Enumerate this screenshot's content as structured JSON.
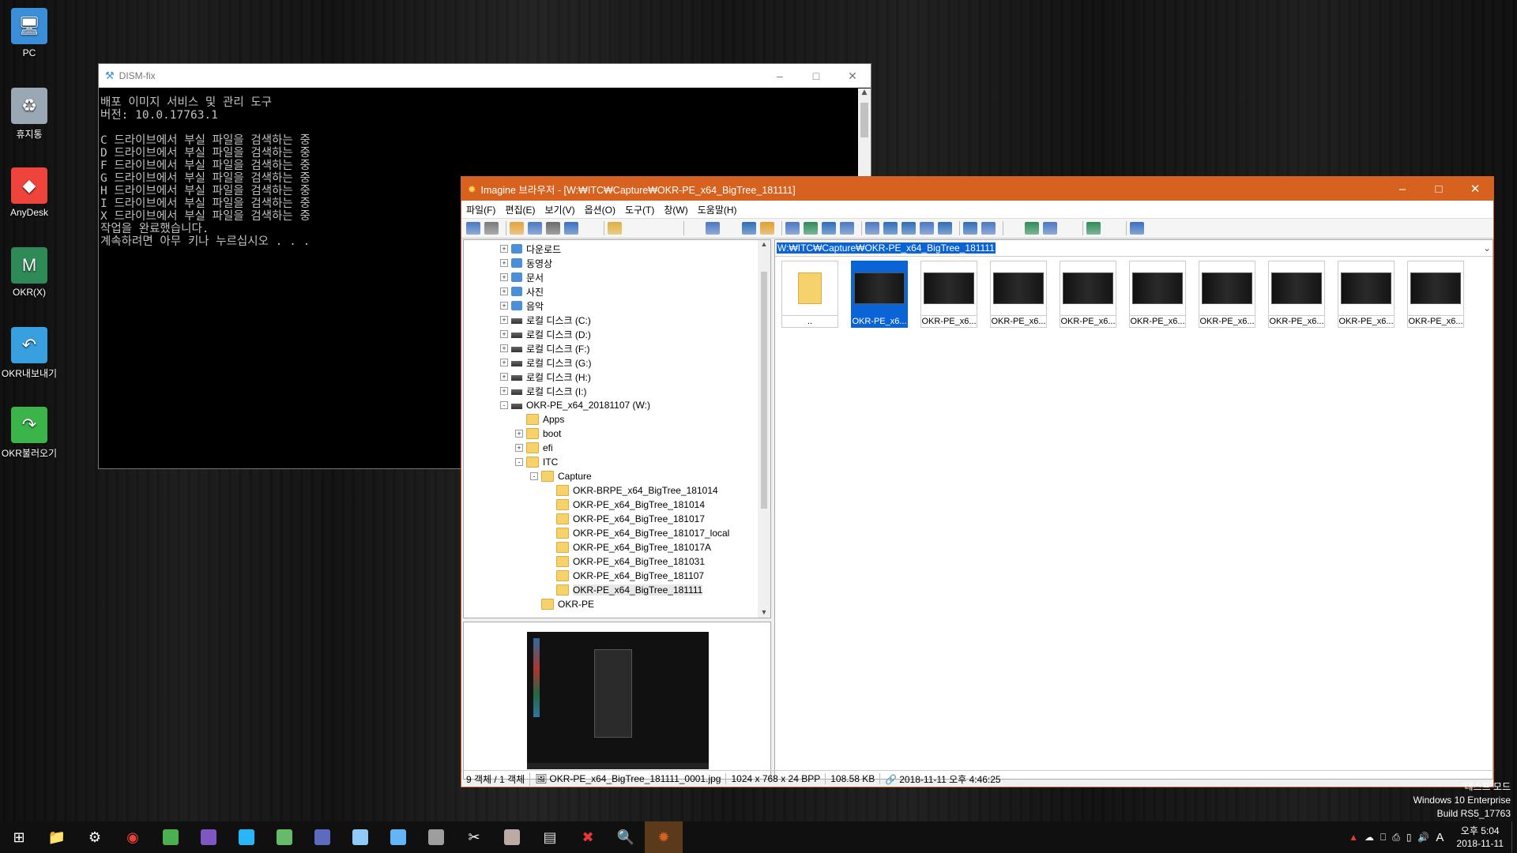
{
  "desktop_icons": [
    {
      "label": "PC",
      "icon": "pc-icon",
      "color": "#3a8fd8"
    },
    {
      "label": "휴지통",
      "icon": "recycle-bin-icon",
      "color": "#9aa7b5"
    },
    {
      "label": "AnyDesk",
      "icon": "anydesk-icon",
      "color": "#ef443b"
    },
    {
      "label": "OKR(X)",
      "icon": "okr-icon",
      "color": "#2e8b57"
    },
    {
      "label": "OKR내보내기",
      "icon": "okr-export-icon",
      "color": "#39a0e0"
    },
    {
      "label": "OKR불러오기",
      "icon": "okr-import-icon",
      "color": "#3bb54a"
    }
  ],
  "console": {
    "title": "DISM-fix",
    "lines": [
      "배포 이미지 서비스 및 관리 도구",
      "버전: 10.0.17763.1",
      "",
      "C 드라이브에서 부실 파일을 검색하는 중",
      "D 드라이브에서 부실 파일을 검색하는 중",
      "F 드라이브에서 부실 파일을 검색하는 중",
      "G 드라이브에서 부실 파일을 검색하는 중",
      "H 드라이브에서 부실 파일을 검색하는 중",
      "I 드라이브에서 부실 파일을 검색하는 중",
      "X 드라이브에서 부실 파일을 검색하는 중",
      "작업을 완료했습니다.",
      "계속하려면 아무 키나 누르십시오 . . ."
    ]
  },
  "browser": {
    "title": "Imagine 브라우저 - [W:₩ITC₩Capture₩OKR-PE_x64_BigTree_181111]",
    "accent": "#d7621f",
    "menu": [
      "파일(F)",
      "편집(E)",
      "보기(V)",
      "옵션(O)",
      "도구(T)",
      "창(W)",
      "도움말(H)"
    ],
    "tree": [
      {
        "label": "다운로드",
        "indent": 0,
        "type": "special",
        "exp": "+"
      },
      {
        "label": "동영상",
        "indent": 0,
        "type": "special",
        "exp": "+"
      },
      {
        "label": "문서",
        "indent": 0,
        "type": "special",
        "exp": "+"
      },
      {
        "label": "사진",
        "indent": 0,
        "type": "special",
        "exp": "+"
      },
      {
        "label": "음악",
        "indent": 0,
        "type": "special",
        "exp": "+"
      },
      {
        "label": "로컬 디스크 (C:)",
        "indent": 0,
        "type": "drive",
        "exp": "+"
      },
      {
        "label": "로컬 디스크 (D:)",
        "indent": 0,
        "type": "drive",
        "exp": "+"
      },
      {
        "label": "로컬 디스크 (F:)",
        "indent": 0,
        "type": "drive",
        "exp": "+"
      },
      {
        "label": "로컬 디스크 (G:)",
        "indent": 0,
        "type": "drive",
        "exp": "+"
      },
      {
        "label": "로컬 디스크 (H:)",
        "indent": 0,
        "type": "drive",
        "exp": "+"
      },
      {
        "label": "로컬 디스크 (I:)",
        "indent": 0,
        "type": "drive",
        "exp": "+"
      },
      {
        "label": "OKR-PE_x64_20181107 (W:)",
        "indent": 0,
        "type": "drive",
        "exp": "-"
      },
      {
        "label": "Apps",
        "indent": 1,
        "type": "folder",
        "exp": ""
      },
      {
        "label": "boot",
        "indent": 1,
        "type": "folder",
        "exp": "+"
      },
      {
        "label": "efi",
        "indent": 1,
        "type": "folder",
        "exp": "+"
      },
      {
        "label": "ITC",
        "indent": 1,
        "type": "folder",
        "exp": "-"
      },
      {
        "label": "Capture",
        "indent": 2,
        "type": "folder",
        "exp": "-"
      },
      {
        "label": "OKR-BRPE_x64_BigTree_181014",
        "indent": 3,
        "type": "folder",
        "exp": ""
      },
      {
        "label": "OKR-PE_x64_BigTree_181014",
        "indent": 3,
        "type": "folder",
        "exp": ""
      },
      {
        "label": "OKR-PE_x64_BigTree_181017",
        "indent": 3,
        "type": "folder",
        "exp": ""
      },
      {
        "label": "OKR-PE_x64_BigTree_181017_local",
        "indent": 3,
        "type": "folder",
        "exp": ""
      },
      {
        "label": "OKR-PE_x64_BigTree_181017A",
        "indent": 3,
        "type": "folder",
        "exp": ""
      },
      {
        "label": "OKR-PE_x64_BigTree_181031",
        "indent": 3,
        "type": "folder",
        "exp": ""
      },
      {
        "label": "OKR-PE_x64_BigTree_181107",
        "indent": 3,
        "type": "folder",
        "exp": ""
      },
      {
        "label": "OKR-PE_x64_BigTree_181111",
        "indent": 3,
        "type": "folder",
        "exp": "",
        "selected": true
      },
      {
        "label": "OKR-PE",
        "indent": 2,
        "type": "folder",
        "exp": ""
      }
    ],
    "address": "W:₩ITC₩Capture₩OKR-PE_x64_BigTree_181111",
    "thumbs": [
      {
        "caption": "..",
        "kind": "folder"
      },
      {
        "caption": "OKR-PE_x6...",
        "kind": "shot",
        "selected": true
      },
      {
        "caption": "OKR-PE_x6...",
        "kind": "shot"
      },
      {
        "caption": "OKR-PE_x6...",
        "kind": "shot"
      },
      {
        "caption": "OKR-PE_x6...",
        "kind": "shot"
      },
      {
        "caption": "OKR-PE_x6...",
        "kind": "shot"
      },
      {
        "caption": "OKR-PE_x6...",
        "kind": "shot"
      },
      {
        "caption": "OKR-PE_x6...",
        "kind": "shot"
      },
      {
        "caption": "OKR-PE_x6...",
        "kind": "shot"
      },
      {
        "caption": "OKR-PE_x6...",
        "kind": "shot"
      }
    ],
    "status": {
      "count": "9 객체 / 1 객체",
      "file": "OKR-PE_x64_BigTree_181111_0001.jpg",
      "dims": "1024 x 768 x 24 BPP",
      "size": "108.58 KB",
      "date": "2018-11-11 오후 4:46:25"
    }
  },
  "watermark": [
    "테스트 모드",
    "Windows 10 Enterprise",
    "Build   RS5_17763"
  ],
  "taskbar": {
    "items": [
      {
        "icon": "start-icon",
        "color": "#ffffff"
      },
      {
        "icon": "explorer-icon",
        "color": "#f5c342"
      },
      {
        "icon": "settings-icon",
        "color": "#ffffff"
      },
      {
        "icon": "chrome-icon",
        "color": "#e94235"
      },
      {
        "icon": "app-icon",
        "color": "#4caf50"
      },
      {
        "icon": "app-icon",
        "color": "#7e57c2"
      },
      {
        "icon": "app-icon",
        "color": "#29b6f6"
      },
      {
        "icon": "app-icon",
        "color": "#66bb6a"
      },
      {
        "icon": "app-icon",
        "color": "#5c6bc0"
      },
      {
        "icon": "app-icon",
        "color": "#90caf9"
      },
      {
        "icon": "app-icon",
        "color": "#64b5f6"
      },
      {
        "icon": "app-icon",
        "color": "#9e9e9e"
      },
      {
        "icon": "tools-icon",
        "color": "#ffffff"
      },
      {
        "icon": "app-icon",
        "color": "#bcaaa4"
      },
      {
        "icon": "cmd-icon",
        "color": "#e0e0e0"
      },
      {
        "icon": "close-app-icon",
        "color": "#e53935"
      },
      {
        "icon": "search-app-icon",
        "color": "#90caf9"
      },
      {
        "icon": "imagine-icon",
        "color": "#d7621f"
      }
    ],
    "clock_time": "오후 5:04",
    "clock_date": "2018-11-11",
    "ime": "A"
  }
}
